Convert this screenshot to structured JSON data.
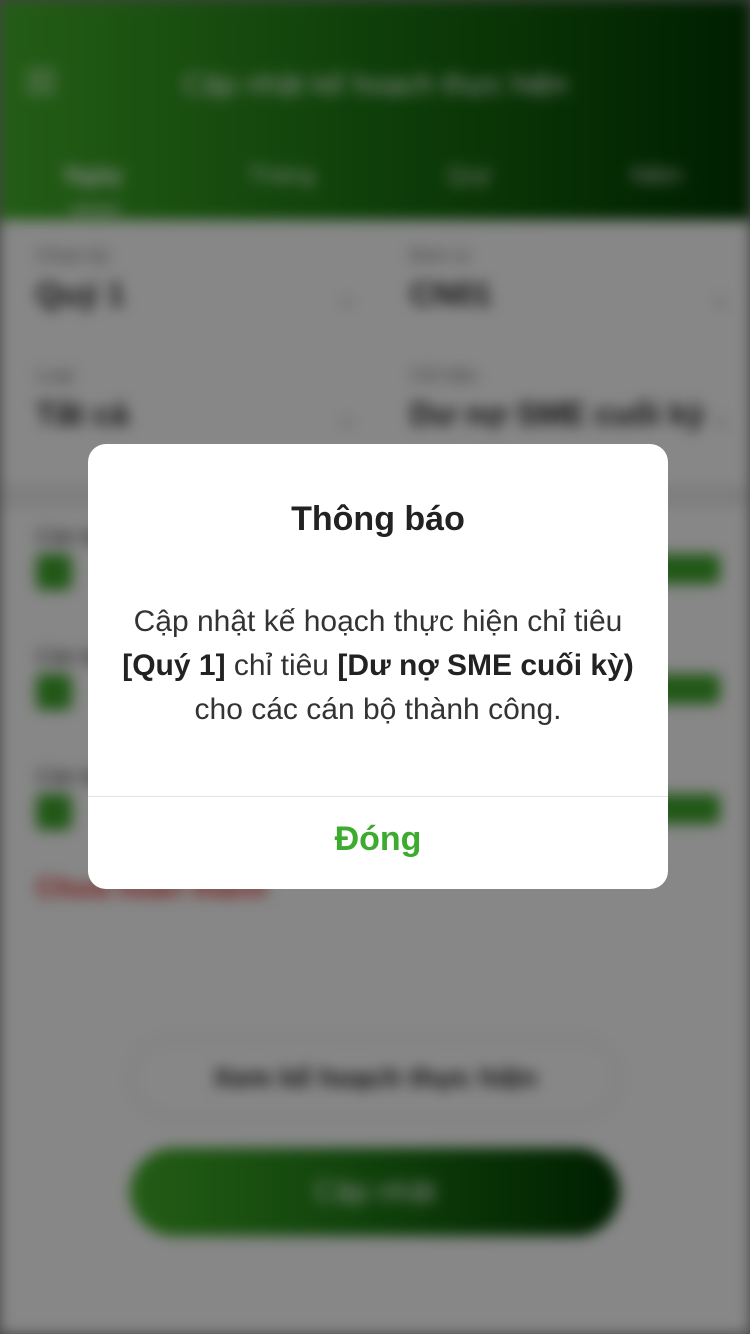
{
  "app": {
    "title": "Cập nhật kế hoạch thực hiện",
    "tabs": [
      "Ngày",
      "Tháng",
      "Quý",
      "Năm"
    ],
    "filters": [
      {
        "label": "Chọn kỳ",
        "value": "Quý 1"
      },
      {
        "label": "Đơn vị",
        "value": "CN01"
      },
      {
        "label": "Loại",
        "value": "Tất cả"
      },
      {
        "label": "Chỉ tiêu",
        "value": "Dư nợ SME cuối kỳ"
      }
    ],
    "rows": [
      "Cán bộ 1",
      "Cán bộ 2",
      "Cán bộ 3"
    ],
    "error_text": "Chưa hoàn thành",
    "outline_button": "Xem kế hoạch thực hiện",
    "primary_button": "Cập nhật"
  },
  "dialog": {
    "title": "Thông báo",
    "message_part1": "Cập nhật kế hoạch thực hiện chỉ tiêu ",
    "period": "[Quý 1]",
    "message_part2": " chỉ tiêu ",
    "indicator": "[Dư nợ SME cuối kỳ)",
    "message_part3": " cho các cán bộ thành công.",
    "close_label": "Đóng"
  },
  "colors": {
    "accent_green": "#3cab2f",
    "header_gradient_start": "#44b02a",
    "header_gradient_end": "#003b00",
    "error_red": "#e0302b"
  },
  "icons": {
    "menu": "hamburger-icon",
    "dropdown": "chevron-down-icon"
  }
}
